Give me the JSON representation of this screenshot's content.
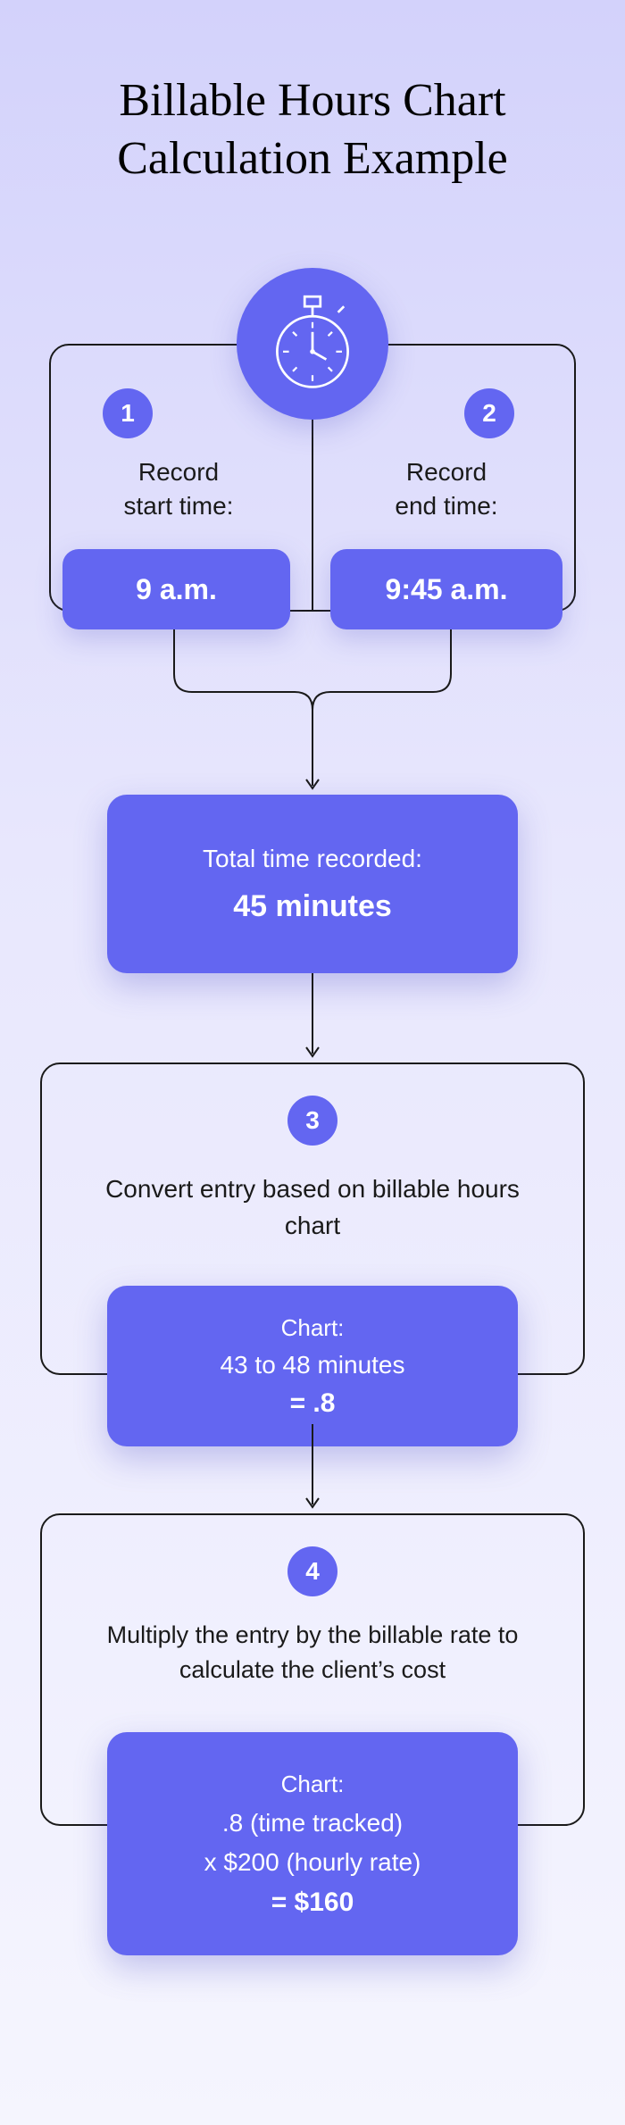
{
  "title_line1": "Billable Hours Chart",
  "title_line2": "Calculation Example",
  "step1": {
    "num": "1",
    "label": "Record\nstart time:",
    "value": "9 a.m."
  },
  "step2": {
    "num": "2",
    "label": "Record\nend time:",
    "value": "9:45 a.m."
  },
  "total": {
    "label": "Total time recorded:",
    "value": "45 minutes"
  },
  "step3": {
    "num": "3",
    "desc": "Convert entry based on billable hours chart",
    "chart_header": "Chart:",
    "chart_range": "43 to 48 minutes",
    "chart_result": "= .8"
  },
  "step4": {
    "num": "4",
    "desc": "Multiply the entry by the billable rate to calculate the client’s cost",
    "chart_header": "Chart:",
    "line1": ".8 (time tracked)",
    "line2": "x $200 (hourly rate)",
    "result": "= $160"
  },
  "colors": {
    "accent": "#6366f1"
  }
}
